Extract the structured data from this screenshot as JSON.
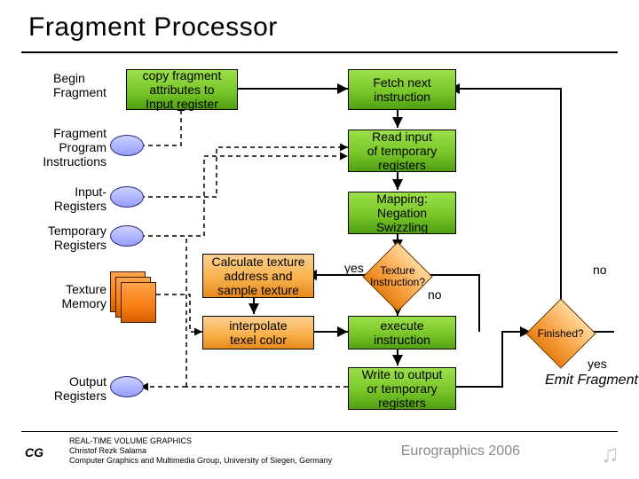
{
  "title": "Fragment Processor",
  "labels": {
    "begin": "Begin\nFragment",
    "fpi": "Fragment\nProgram\nInstructions",
    "inreg": "Input-\nRegisters",
    "tmpreg": "Temporary\nRegisters",
    "texmem": "Texture\nMemory",
    "outreg": "Output\nRegisters"
  },
  "boxes": {
    "copy": "copy fragment\nattributes to\nInput register",
    "fetch": "Fetch next\ninstruction",
    "read": "Read input\nof temporary\nregisters",
    "map": "Mapping:\nNegation\nSwizzling",
    "calc": "Calculate texture\naddress and\nsample texture",
    "interp": "interpolate\ntexel color",
    "exec": "execute\ninstruction",
    "write": "Write to output\nor temporary\nregisters"
  },
  "diamonds": {
    "texq": "Texture\nInstruction?",
    "fin": "Finished?"
  },
  "edges": {
    "yes": "yes",
    "no": "no"
  },
  "emit": "Emit Fragment",
  "footer": {
    "l1": "REAL-TIME VOLUME GRAPHICS",
    "l2": "Christof Rezk Salama",
    "l3": "Computer Graphics and Multimedia Group, University of Siegen, Germany",
    "cg": "CG",
    "euro": "Eurographics 2006",
    "note": "♫"
  }
}
